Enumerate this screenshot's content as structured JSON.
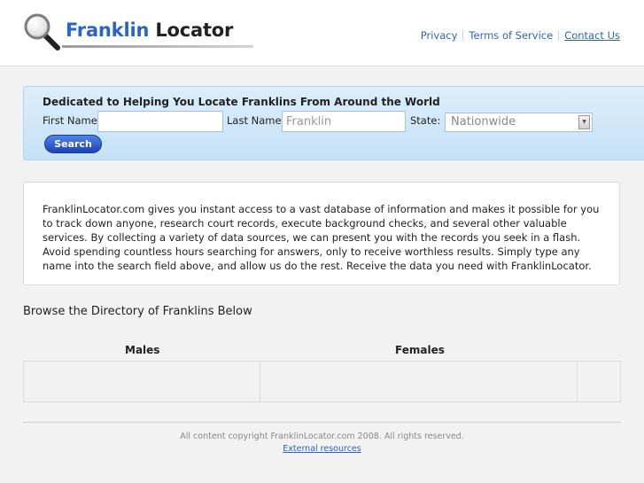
{
  "header": {
    "logo_brand": "Franklin",
    "logo_rest": " Locator",
    "nav": [
      "Privacy",
      "Terms of Service",
      "Contact Us"
    ]
  },
  "search": {
    "title": "Dedicated to Helping You Locate Franklins From Around the World",
    "first_name_label": "First Name",
    "first_name_value": "",
    "last_name_label": "Last Name",
    "last_name_value": "Franklin",
    "state_label": "State:",
    "state_value": "Nationwide",
    "button": "Search"
  },
  "info": {
    "text": "FranklinLocator.com gives you instant access to a vast database of information and makes it possible for you to track down anyone, research court records, execute background checks, and several other valuable services. By collecting a variety of data sources, we can present you with the records you seek in a flash. Avoid spending countless hours searching for answers, only to receive worthless results. Simply type any name into the search field above, and allow us do the rest. Receive the data you need with FranklinLocator."
  },
  "directory": {
    "title": "Browse the Directory of Franklins Below",
    "columns": [
      "Males",
      "Females"
    ]
  },
  "footer": {
    "copyright": "All content copyright FranklinLocator.com 2008. All rights reserved.",
    "link": "External resources"
  },
  "colors": {
    "brand_blue": "#2b64c8",
    "search_panel": "#cfe6f8",
    "button": "#2a56cc"
  },
  "icons": {
    "logo": "magnifier-icon",
    "select_arrow": "chevron-down-icon"
  }
}
